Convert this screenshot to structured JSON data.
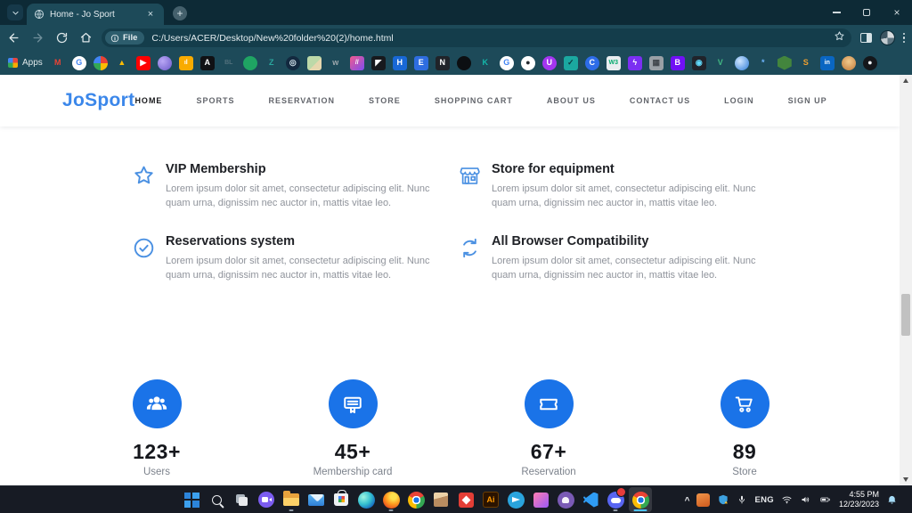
{
  "browser": {
    "tab": {
      "title": "Home - Jo Sport"
    },
    "address": {
      "chip": "File",
      "url": "C:/Users/ACER/Desktop/New%20folder%20(2)/home.html"
    },
    "bookmarks_bar": {
      "apps_label": "Apps",
      "bookmarks": [
        {
          "name": "gmail",
          "glyph": "M",
          "fg": "#ea4335",
          "bg": "",
          "shape": "none"
        },
        {
          "name": "google",
          "glyph": "G",
          "fg": "#4285f4",
          "bg": "#ffffff",
          "shape": "circle"
        },
        {
          "name": "google-photos",
          "glyph": "",
          "fg": "",
          "bg": "conic-gradient(#ea4335 0 25%,#fbbc04 0 50%,#34a853 0 75%,#4285f4 0)",
          "shape": "circle"
        },
        {
          "name": "google-drive",
          "glyph": "▲",
          "fg": "#fbbc04",
          "bg": "",
          "shape": "none"
        },
        {
          "name": "youtube",
          "glyph": "▶",
          "fg": "#ffffff",
          "bg": "#ff0000",
          "shape": "square"
        },
        {
          "name": "purple-planet",
          "glyph": "",
          "fg": "",
          "bg": "radial-gradient(circle at 35% 35%,#b9a7f5,#6b59c9)",
          "shape": "circle"
        },
        {
          "name": "analytics",
          "glyph": "ıl",
          "fg": "#ffffff",
          "bg": "#f9ab00",
          "shape": "square"
        },
        {
          "name": "a-black",
          "glyph": "A",
          "fg": "#ffffff",
          "bg": "#101114",
          "shape": "square"
        },
        {
          "name": "dim-gray",
          "glyph": "BL",
          "fg": "#51707c",
          "bg": "",
          "shape": "none"
        },
        {
          "name": "green-swirl",
          "glyph": "",
          "fg": "",
          "bg": "#1fa463",
          "shape": "circle"
        },
        {
          "name": "z-teal",
          "glyph": "Z",
          "fg": "#2aa79e",
          "bg": "",
          "shape": "none"
        },
        {
          "name": "dark-globe",
          "glyph": "◎",
          "fg": "#d7e6ee",
          "bg": "#13293f",
          "shape": "circle"
        },
        {
          "name": "map-thumbnail",
          "glyph": "",
          "fg": "",
          "bg": "linear-gradient(135deg,#bcd9a8 0 55%,#e6d7ae 55%)",
          "shape": "square"
        },
        {
          "name": "w-gray",
          "glyph": "w",
          "fg": "#9fa9ae",
          "bg": "",
          "shape": "none"
        },
        {
          "name": "pink-slashes",
          "glyph": "//",
          "fg": "#ffffff",
          "bg": "linear-gradient(135deg,#f25a8e,#7d4df0)",
          "shape": "square"
        },
        {
          "name": "black-tile",
          "glyph": "◤",
          "fg": "#ffffff",
          "bg": "#17191d",
          "shape": "square"
        },
        {
          "name": "h-blue",
          "glyph": "H",
          "fg": "#ffffff",
          "bg": "#1868d6",
          "shape": "square"
        },
        {
          "name": "e-blue",
          "glyph": "E",
          "fg": "#ffffff",
          "bg": "#2e6de0",
          "shape": "square"
        },
        {
          "name": "n-black",
          "glyph": "N",
          "fg": "#ffffff",
          "bg": "#202329",
          "shape": "square"
        },
        {
          "name": "paw",
          "glyph": "",
          "fg": "",
          "bg": "#0c0f12",
          "shape": "circle"
        },
        {
          "name": "k-teal",
          "glyph": "K",
          "fg": "#14b8ab",
          "bg": "",
          "shape": "none"
        },
        {
          "name": "google-2",
          "glyph": "G",
          "fg": "#4285f4",
          "bg": "#ffffff",
          "shape": "circle"
        },
        {
          "name": "github-light",
          "glyph": "●",
          "fg": "#24292f",
          "bg": "#ffffff",
          "shape": "circle"
        },
        {
          "name": "udemy",
          "glyph": "U",
          "fg": "#ffffff",
          "bg": "#a435f0",
          "shape": "circle"
        },
        {
          "name": "shield-check",
          "glyph": "✓",
          "fg": "#0c3a40",
          "bg": "#1ba8a0",
          "shape": "square"
        },
        {
          "name": "c-blue",
          "glyph": "C",
          "fg": "#ffffff",
          "bg": "#2d6ce8",
          "shape": "circle"
        },
        {
          "name": "w3schools",
          "glyph": "W3",
          "fg": "#04aa6d",
          "bg": "#e9edf0",
          "shape": "square"
        },
        {
          "name": "bolt-purple",
          "glyph": "ϟ",
          "fg": "#ffffff",
          "bg": "#7b2ff2",
          "shape": "square"
        },
        {
          "name": "qr-gray",
          "glyph": "▦",
          "fg": "#41464c",
          "bg": "#9aa0a6",
          "shape": "square"
        },
        {
          "name": "bootstrap",
          "glyph": "B",
          "fg": "#ffffff",
          "bg": "#7110f5",
          "shape": "square"
        },
        {
          "name": "react",
          "glyph": "◉",
          "fg": "#61dafb",
          "bg": "#20232a",
          "shape": "square"
        },
        {
          "name": "vue",
          "glyph": "V",
          "fg": "#42b883",
          "bg": "",
          "shape": "none"
        },
        {
          "name": "blue-swirl",
          "glyph": "",
          "fg": "",
          "bg": "radial-gradient(circle at 35% 35%,#cfe6ff,#2e7cd6)",
          "shape": "circle"
        },
        {
          "name": "sparkle",
          "glyph": "*",
          "fg": "#6fb6ff",
          "bg": "",
          "shape": "none"
        },
        {
          "name": "nodejs",
          "glyph": "",
          "fg": "",
          "bg": "#43853d",
          "shape": "hex"
        },
        {
          "name": "orange-curl",
          "glyph": "S",
          "fg": "#f0a030",
          "bg": "",
          "shape": "none"
        },
        {
          "name": "linkedin",
          "glyph": "in",
          "fg": "#ffffff",
          "bg": "#0a66c2",
          "shape": "square"
        },
        {
          "name": "avatar-orange",
          "glyph": "",
          "fg": "",
          "bg": "radial-gradient(circle at 50% 38%,#f2c98c,#c07a3a)",
          "shape": "circle"
        },
        {
          "name": "github-dark",
          "glyph": "●",
          "fg": "#f0f3f5",
          "bg": "#14171b",
          "shape": "circle"
        }
      ]
    }
  },
  "page": {
    "logo": "JoSport",
    "nav": [
      {
        "label": "HOME",
        "active": true
      },
      {
        "label": "SPORTS",
        "active": false
      },
      {
        "label": "RESERVATION",
        "active": false
      },
      {
        "label": "STORE",
        "active": false
      },
      {
        "label": "SHOPPING CART",
        "active": false
      },
      {
        "label": "ABOUT US",
        "active": false
      },
      {
        "label": "CONTACT US",
        "active": false
      },
      {
        "label": "LOGIN",
        "active": false
      },
      {
        "label": "SIGN UP",
        "active": false
      }
    ],
    "features": [
      {
        "icon": "star",
        "title": "VIP Membership",
        "text": "Lorem ipsum dolor sit amet, consectetur adipiscing elit. Nunc quam urna, dignissim nec auctor in, mattis vitae leo."
      },
      {
        "icon": "storefront",
        "title": "Store for equipment",
        "text": "Lorem ipsum dolor sit amet, consectetur adipiscing elit. Nunc quam urna, dignissim nec auctor in, mattis vitae leo."
      },
      {
        "icon": "check-circle",
        "title": "Reservations system",
        "text": "Lorem ipsum dolor sit amet, consectetur adipiscing elit. Nunc quam urna, dignissim nec auctor in, mattis vitae leo."
      },
      {
        "icon": "sync",
        "title": "All Browser Compatibility",
        "text": "Lorem ipsum dolor sit amet, consectetur adipiscing elit. Nunc quam urna, dignissim nec auctor in, mattis vitae leo."
      }
    ],
    "stats": [
      {
        "icon": "users",
        "value": "123+",
        "label": "Users"
      },
      {
        "icon": "membership-card",
        "value": "45+",
        "label": "Membership card"
      },
      {
        "icon": "ticket",
        "value": "67+",
        "label": "Reservation"
      },
      {
        "icon": "cart",
        "value": "89",
        "label": "Store"
      }
    ]
  },
  "taskbar": {
    "items": [
      {
        "name": "start",
        "cls": "i-start"
      },
      {
        "name": "search",
        "cls": "i-search"
      },
      {
        "name": "task-view",
        "cls": "i-taskview"
      },
      {
        "name": "chat",
        "cls": "i-chat"
      },
      {
        "name": "file-explorer",
        "cls": "i-folder",
        "dot": true
      },
      {
        "name": "mail",
        "cls": "i-mail"
      },
      {
        "name": "microsoft-store",
        "cls": "i-store"
      },
      {
        "name": "edge",
        "cls": "i-edge"
      },
      {
        "name": "firefox",
        "cls": "i-firefox",
        "dot": true
      },
      {
        "name": "chrome",
        "cls": "i-chrome"
      },
      {
        "name": "3d-viewer",
        "cls": "i-cube"
      },
      {
        "name": "red-diamond-app",
        "cls": "i-redapp"
      },
      {
        "name": "illustrator",
        "cls": "i-illustrator",
        "glyph": "Ai"
      },
      {
        "name": "telegram",
        "cls": "i-telegram"
      },
      {
        "name": "pink-gradient-app",
        "cls": "i-pinkapp"
      },
      {
        "name": "github-desktop",
        "cls": "i-ghdesk"
      },
      {
        "name": "vscode",
        "cls": "i-vscode"
      },
      {
        "name": "discord",
        "cls": "i-discord",
        "dot": true,
        "badge": true
      },
      {
        "name": "chrome-active",
        "cls": "i-chrome",
        "active": true
      }
    ],
    "tray": {
      "language": "ENG",
      "time": "4:55 PM",
      "date": "12/23/2023"
    }
  },
  "colors": {
    "accent_blue": "#3b87ea",
    "stat_circle_blue": "#1a73e8",
    "browser_teal": "#1d4a59",
    "titlebar_dark": "#0d2a36",
    "taskbar_dark": "#171b24"
  }
}
